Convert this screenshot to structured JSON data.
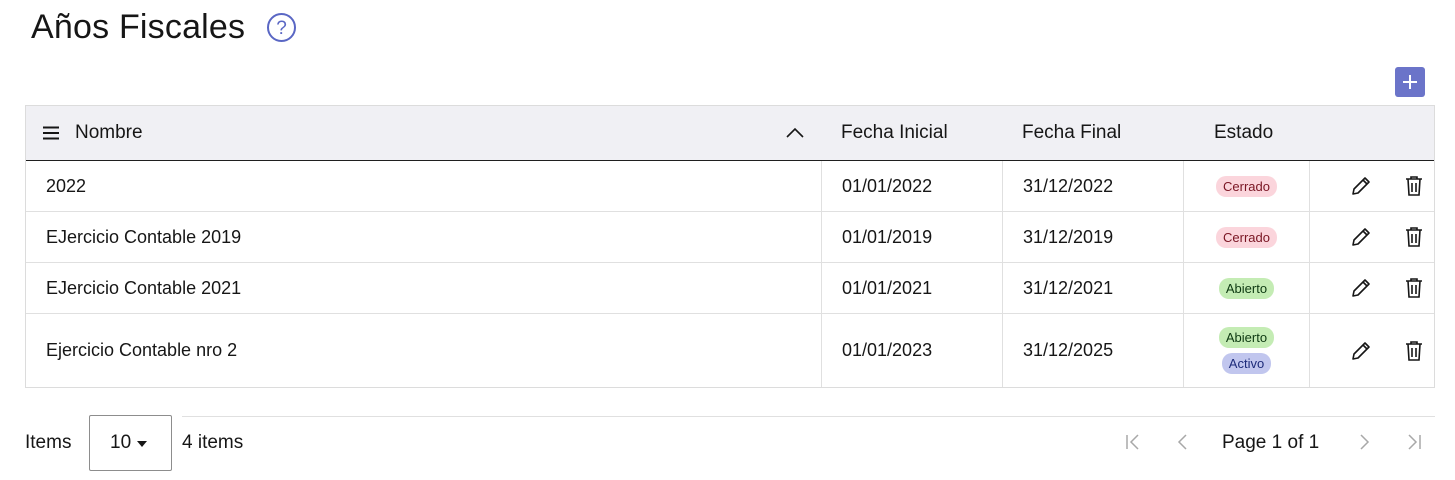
{
  "header": {
    "title": "Años Fiscales",
    "help_icon": "question-circle-icon",
    "add_icon": "plus-icon"
  },
  "table": {
    "columns": [
      "Nombre",
      "Fecha Inicial",
      "Fecha Final",
      "Estado"
    ],
    "rows": [
      {
        "nombre": "2022",
        "fecha_inicial": "01/01/2022",
        "fecha_final": "31/12/2022",
        "estado": [
          "Cerrado"
        ]
      },
      {
        "nombre": "EJercicio Contable 2019",
        "fecha_inicial": "01/01/2019",
        "fecha_final": "31/12/2019",
        "estado": [
          "Cerrado"
        ]
      },
      {
        "nombre": "EJercicio Contable 2021",
        "fecha_inicial": "01/01/2021",
        "fecha_final": "31/12/2021",
        "estado": [
          "Abierto"
        ]
      },
      {
        "nombre": "Ejercicio Contable nro 2",
        "fecha_inicial": "01/01/2023",
        "fecha_final": "31/12/2025",
        "estado": [
          "Abierto",
          "Activo"
        ]
      }
    ]
  },
  "footer": {
    "items_label": "Items",
    "page_size": "10",
    "items_count": "4 items",
    "page_text": "Page 1 of 1"
  },
  "colors": {
    "accent": "#6b74c9",
    "cerrado_bg": "#fbd5dc",
    "abierto_bg": "#c4ecb4",
    "activo_bg": "#c1c6ee"
  }
}
